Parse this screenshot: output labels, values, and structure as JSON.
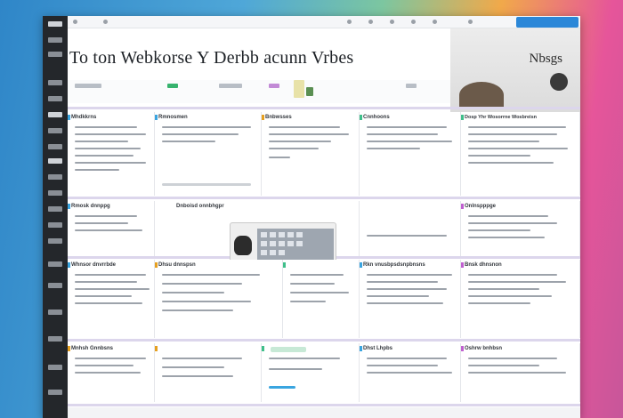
{
  "window": {
    "title": "To ton Webkorse Y Derbb acunn Vrbes",
    "brand": "Nbsgs",
    "cta_color": "#2b87d8"
  },
  "grid": {
    "row1": [
      "Mhdkkrns",
      "Rmnosmen",
      "Bnbwsses",
      "Cnnhoons",
      "Dosp Yhr Wosorrne Wosbreisn"
    ],
    "row2": [
      "Rmosk dnnppg",
      "Dnboisd onnbhgpr",
      "Onlnspppge"
    ],
    "row3": [
      "Whnsor dnvrrbde",
      "Dhsu dnnspsn",
      "Rkn vnusbpsdsnpbnsns",
      "Bnsk dhnsnon"
    ],
    "row4": [
      "Mnhsh Gnnbsns",
      "Dhst Lhpbs",
      "Oshrw bnhbsn"
    ]
  }
}
